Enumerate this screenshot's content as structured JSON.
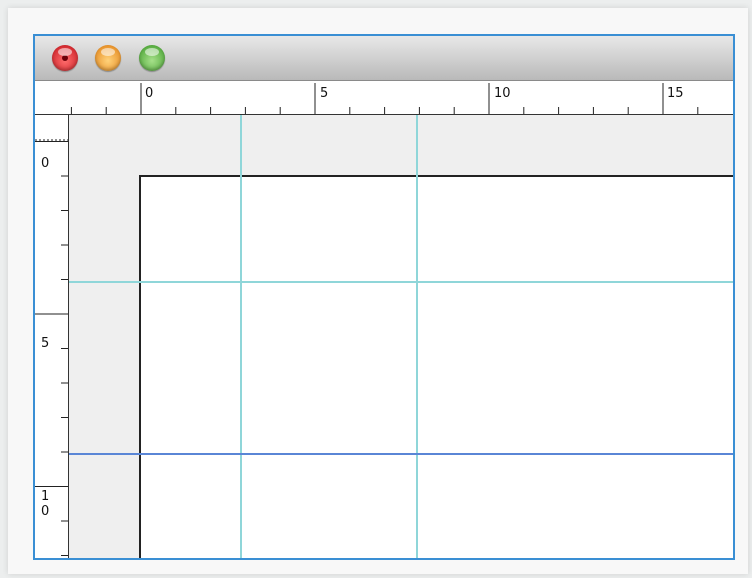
{
  "window": {
    "controls": [
      "close-button",
      "minimize-button",
      "zoom-button"
    ],
    "colors": {
      "close": "#d9262e",
      "minimize": "#f29a23",
      "zoom": "#5fb83f",
      "guide": "#8fd6d9",
      "selected_guide": "#5a86d6",
      "window_border": "#3a8fd4"
    }
  },
  "horizontal_ruler": {
    "labels": [
      "0",
      "5",
      "10",
      "15"
    ]
  },
  "vertical_ruler": {
    "labels": [
      "0",
      "5",
      "1",
      "0"
    ]
  },
  "guides": {
    "vertical_count": 2,
    "horizontal_count": 2,
    "selected": "lower horizontal guide"
  }
}
